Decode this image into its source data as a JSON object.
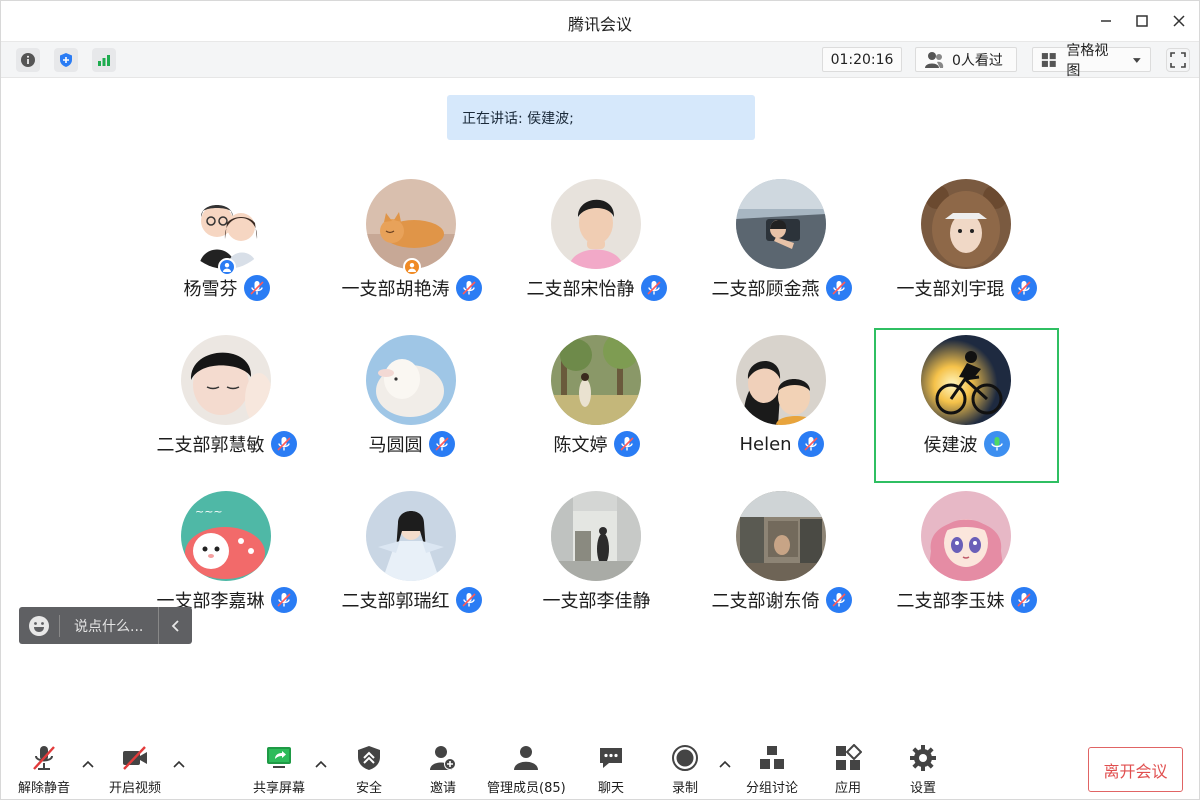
{
  "window": {
    "title": "腾讯会议"
  },
  "toolbar": {
    "timer": "01:20:16",
    "viewers": "0人看过",
    "view_mode": "宫格视图"
  },
  "speaking_banner": "正在讲话: 侯建波;",
  "colors": {
    "accent": "#2a7cf4",
    "active_border": "#2fbf62",
    "leave": "#e04f4f",
    "speaking_bg": "#d6e8fb"
  },
  "participants": [
    {
      "name": "杨雪芬",
      "avatar": "cartoon-couple",
      "badge": "host-blue",
      "muted": true
    },
    {
      "name": "一支部胡艳涛",
      "avatar": "sleeping-cat",
      "badge": "cohost-orange",
      "muted": true
    },
    {
      "name": "二支部宋怡静",
      "avatar": "person-photo",
      "muted": true
    },
    {
      "name": "二支部顾金燕",
      "avatar": "car-photo",
      "muted": true
    },
    {
      "name": "一支部刘宇琨",
      "avatar": "bear-costume",
      "muted": true
    },
    {
      "name": "二支部郭慧敏",
      "avatar": "face-photo",
      "muted": true
    },
    {
      "name": "马圆圆",
      "avatar": "lamb-photo",
      "muted": true
    },
    {
      "name": "陈文婷",
      "avatar": "forest-photo",
      "muted": true
    },
    {
      "name": "Helen",
      "avatar": "family-photo",
      "muted": true
    },
    {
      "name": "侯建波",
      "avatar": "cyclist-photo",
      "muted": false,
      "speaking": true
    },
    {
      "name": "一支部李嘉琳",
      "avatar": "cartoon-panda",
      "muted": true
    },
    {
      "name": "二支部郭瑞红",
      "avatar": "costume-photo",
      "muted": true
    },
    {
      "name": "一支部李佳静",
      "avatar": "hallway-photo",
      "muted": null
    },
    {
      "name": "二支部谢东倚",
      "avatar": "street-photo",
      "muted": true
    },
    {
      "name": "二支部李玉妹",
      "avatar": "anime-girl",
      "muted": true
    }
  ],
  "chat": {
    "placeholder": "说点什么..."
  },
  "controls": {
    "unmute": "解除静音",
    "start_video": "开启视频",
    "share_screen": "共享屏幕",
    "security": "安全",
    "invite": "邀请",
    "manage_members": "管理成员(85)",
    "chat": "聊天",
    "record": "录制",
    "breakout": "分组讨论",
    "apps": "应用",
    "settings": "设置",
    "leave": "离开会议"
  }
}
